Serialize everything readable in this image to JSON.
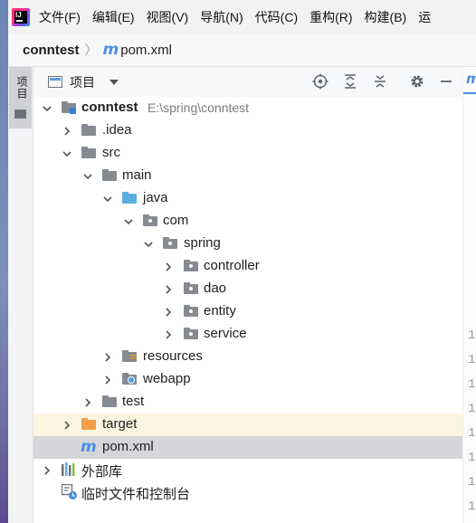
{
  "menubar": {
    "items": [
      "文件(F)",
      "编辑(E)",
      "视图(V)",
      "导航(N)",
      "代码(C)",
      "重构(R)",
      "构建(B)",
      "运"
    ]
  },
  "breadcrumb": {
    "project": "conntest",
    "file": "pom.xml"
  },
  "toolstrip": {
    "project_label": "项目"
  },
  "panel": {
    "view_label": "项目"
  },
  "tree": {
    "root": {
      "label": "conntest",
      "path": "E:\\spring\\conntest"
    },
    "idea": ".idea",
    "src": "src",
    "main": "main",
    "java": "java",
    "com": "com",
    "spring": "spring",
    "controller": "controller",
    "dao": "dao",
    "entity": "entity",
    "service": "service",
    "resources": "resources",
    "webapp": "webapp",
    "test": "test",
    "target": "target",
    "pom": "pom.xml",
    "external_libs": "外部库",
    "scratches": "临时文件和控制台"
  },
  "editor": {
    "gutter": [
      "1",
      "1",
      "1",
      "1",
      "1",
      "1",
      "1",
      "1"
    ]
  },
  "colors": {
    "accent": "#4a8ee6",
    "selected_row": "#d5d6d9",
    "excluded_row": "#fbf6e1"
  }
}
